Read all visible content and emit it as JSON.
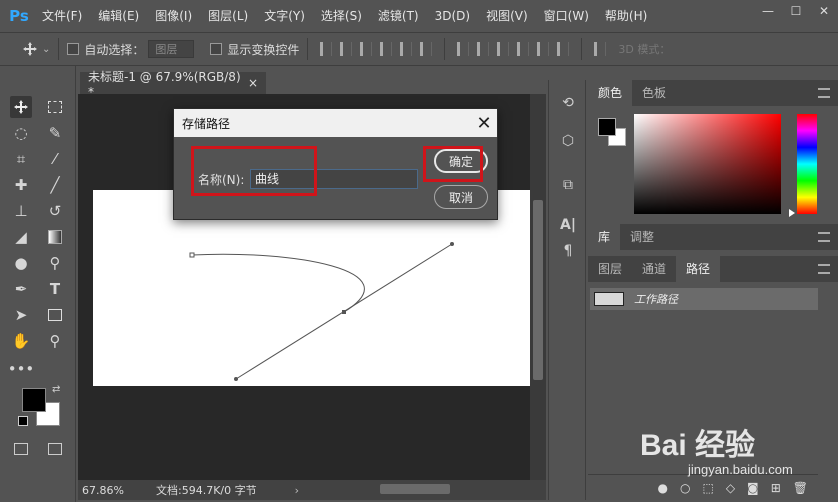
{
  "app": {
    "logo": "Ps"
  },
  "menu": [
    "文件(F)",
    "编辑(E)",
    "图像(I)",
    "图层(L)",
    "文字(Y)",
    "选择(S)",
    "滤镜(T)",
    "3D(D)",
    "视图(V)",
    "窗口(W)",
    "帮助(H)"
  ],
  "window_controls": {
    "minimize": "—",
    "maximize": "☐",
    "close": "✕"
  },
  "options": {
    "auto_select_label": "自动选择：",
    "auto_select_value": "图层",
    "show_transform_label": "显示变换控件",
    "mode_3d_label": "3D 模式："
  },
  "document": {
    "tab_title": "未标题-1 @ 67.9%(RGB/8) *",
    "tab_close": "×",
    "zoom_status": "67.86%",
    "doc_info": "文档:594.7K/0 字节"
  },
  "dialog": {
    "title": "存储路径",
    "close": "✕",
    "name_label": "名称(N):",
    "name_value": "曲线",
    "ok_label": "确定",
    "cancel_label": "取消"
  },
  "panels": {
    "color_tabs": [
      "颜色",
      "色板"
    ],
    "library_tabs": [
      "库",
      "调整"
    ],
    "layer_tabs": [
      "图层",
      "通道",
      "路径"
    ],
    "active_path_name": "工作路径"
  },
  "colors": {
    "foreground": "#000000",
    "background": "#ffffff",
    "highlight": "#d0141a"
  },
  "watermark": {
    "logo": "Bai 经验",
    "url": "jingyan.baidu.com"
  }
}
